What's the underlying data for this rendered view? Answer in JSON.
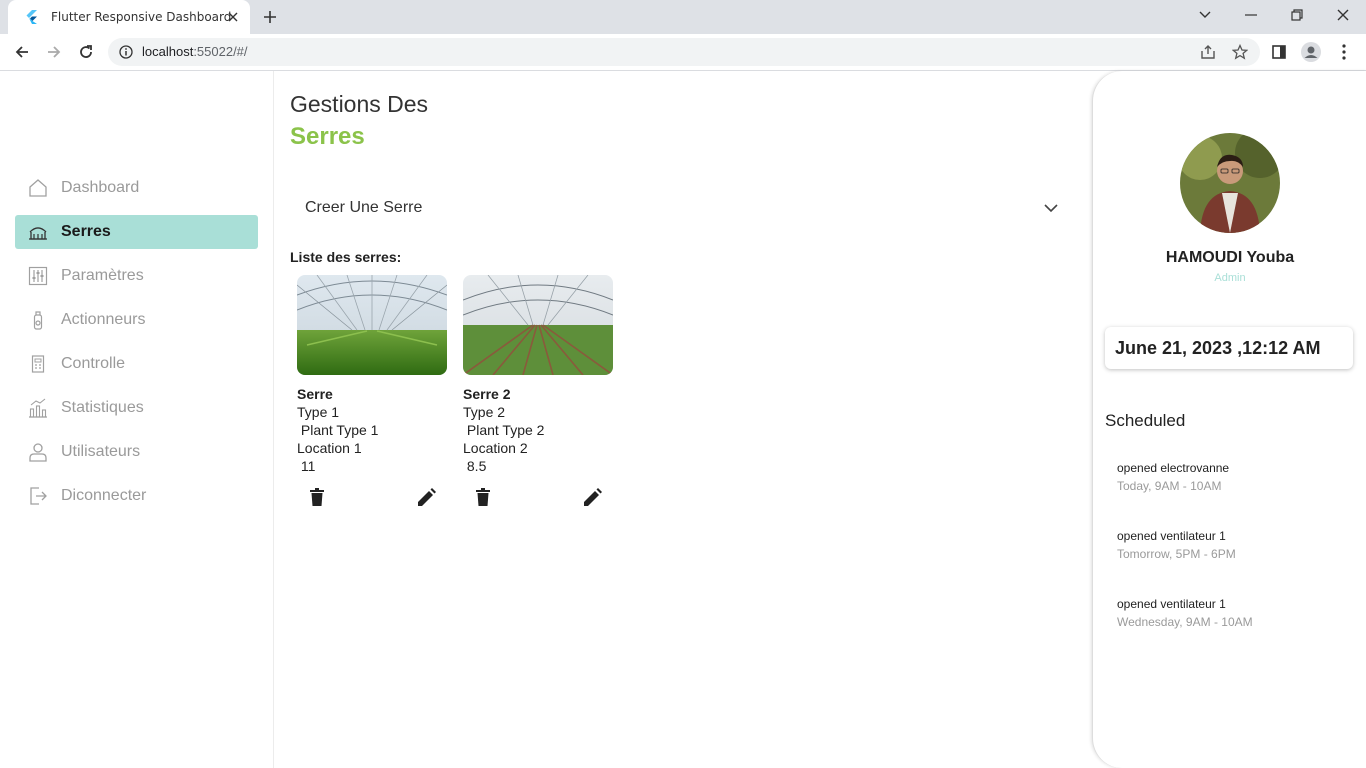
{
  "browser": {
    "tab_title": "Flutter Responsive Dashboard",
    "url_host": "localhost",
    "url_rest": ":55022/#/"
  },
  "sidebar": {
    "items": [
      {
        "label": "Dashboard",
        "icon": "home-icon",
        "active": false
      },
      {
        "label": "Serres",
        "icon": "greenhouse-icon",
        "active": true
      },
      {
        "label": "Paramètres",
        "icon": "sliders-icon",
        "active": false
      },
      {
        "label": "Actionneurs",
        "icon": "actuator-icon",
        "active": false
      },
      {
        "label": "Controlle",
        "icon": "control-icon",
        "active": false
      },
      {
        "label": "Statistiques",
        "icon": "chart-icon",
        "active": false
      },
      {
        "label": "Utilisateurs",
        "icon": "user-icon",
        "active": false
      },
      {
        "label": "Diconnecter",
        "icon": "logout-icon",
        "active": false
      }
    ]
  },
  "main": {
    "title_line1": "Gestions Des",
    "title_line2": "Serres",
    "dropdown_label": "Creer Une Serre",
    "list_title": "Liste des serres:",
    "cards": [
      {
        "name": "Serre",
        "type": "Type 1",
        "plant": " Plant Type 1",
        "location": "Location 1",
        "value": " 11"
      },
      {
        "name": "Serre 2",
        "type": "Type 2",
        "plant": " Plant Type 2",
        "location": "Location 2",
        "value": " 8.5"
      }
    ]
  },
  "profile": {
    "name": "HAMOUDI Youba",
    "role": "Admin",
    "datetime": "June 21, 2023 ,12:12 AM"
  },
  "schedule": {
    "title": "Scheduled",
    "events": [
      {
        "title": "opened electrovanne",
        "time": "Today, 9AM - 10AM"
      },
      {
        "title": "opened ventilateur 1",
        "time": "Tomorrow, 5PM - 6PM"
      },
      {
        "title": "opened ventilateur 1",
        "time": "Wednesday, 9AM - 10AM"
      }
    ]
  },
  "colors": {
    "accent_green": "#8bc34a",
    "active_bg": "#a9dfd7",
    "role_color": "#a9dfd7"
  }
}
